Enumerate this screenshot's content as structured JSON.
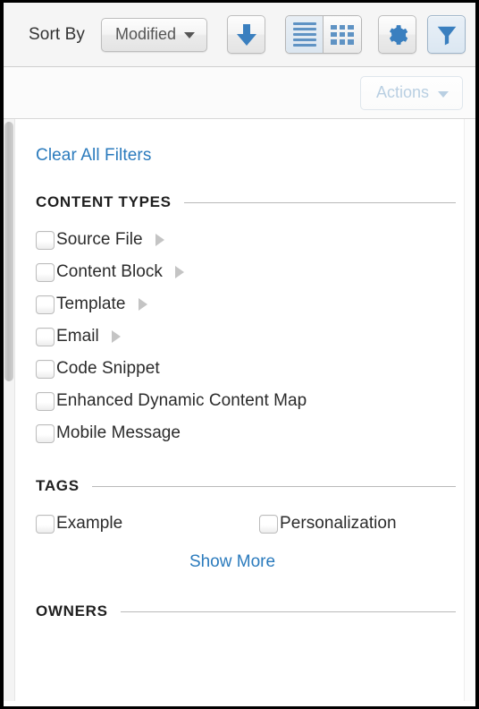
{
  "toolbar": {
    "sort_by_label": "Sort By",
    "sort_field_value": "Modified",
    "sort_direction_icon": "arrow-down-icon",
    "view_list_icon": "list-view-icon",
    "view_grid_icon": "grid-view-icon",
    "settings_icon": "gear-icon",
    "filter_icon": "funnel-icon",
    "active_view": "list",
    "filter_active": true,
    "accent_color": "#3a7fbf",
    "background_color": "#f5f5f5"
  },
  "actions_bar": {
    "actions_label": "Actions",
    "actions_enabled": false,
    "caret_icon": "chevron-down-icon"
  },
  "filter_panel": {
    "clear_all_label": "Clear All Filters",
    "link_color": "#2b7bbd",
    "sections": [
      {
        "title": "CONTENT TYPES",
        "options": [
          {
            "label": "Source File",
            "checked": false,
            "expandable": true
          },
          {
            "label": "Content Block",
            "checked": false,
            "expandable": true
          },
          {
            "label": "Template",
            "checked": false,
            "expandable": true
          },
          {
            "label": "Email",
            "checked": false,
            "expandable": true
          },
          {
            "label": "Code Snippet",
            "checked": false,
            "expandable": false
          },
          {
            "label": "Enhanced Dynamic Content Map",
            "checked": false,
            "expandable": false
          },
          {
            "label": "Mobile Message",
            "checked": false,
            "expandable": false
          }
        ]
      },
      {
        "title": "TAGS",
        "options": [
          {
            "label": "Example",
            "checked": false,
            "expandable": false
          },
          {
            "label": "Personalization",
            "checked": false,
            "expandable": false
          }
        ],
        "show_more_label": "Show More"
      },
      {
        "title": "OWNERS",
        "options": []
      }
    ]
  }
}
